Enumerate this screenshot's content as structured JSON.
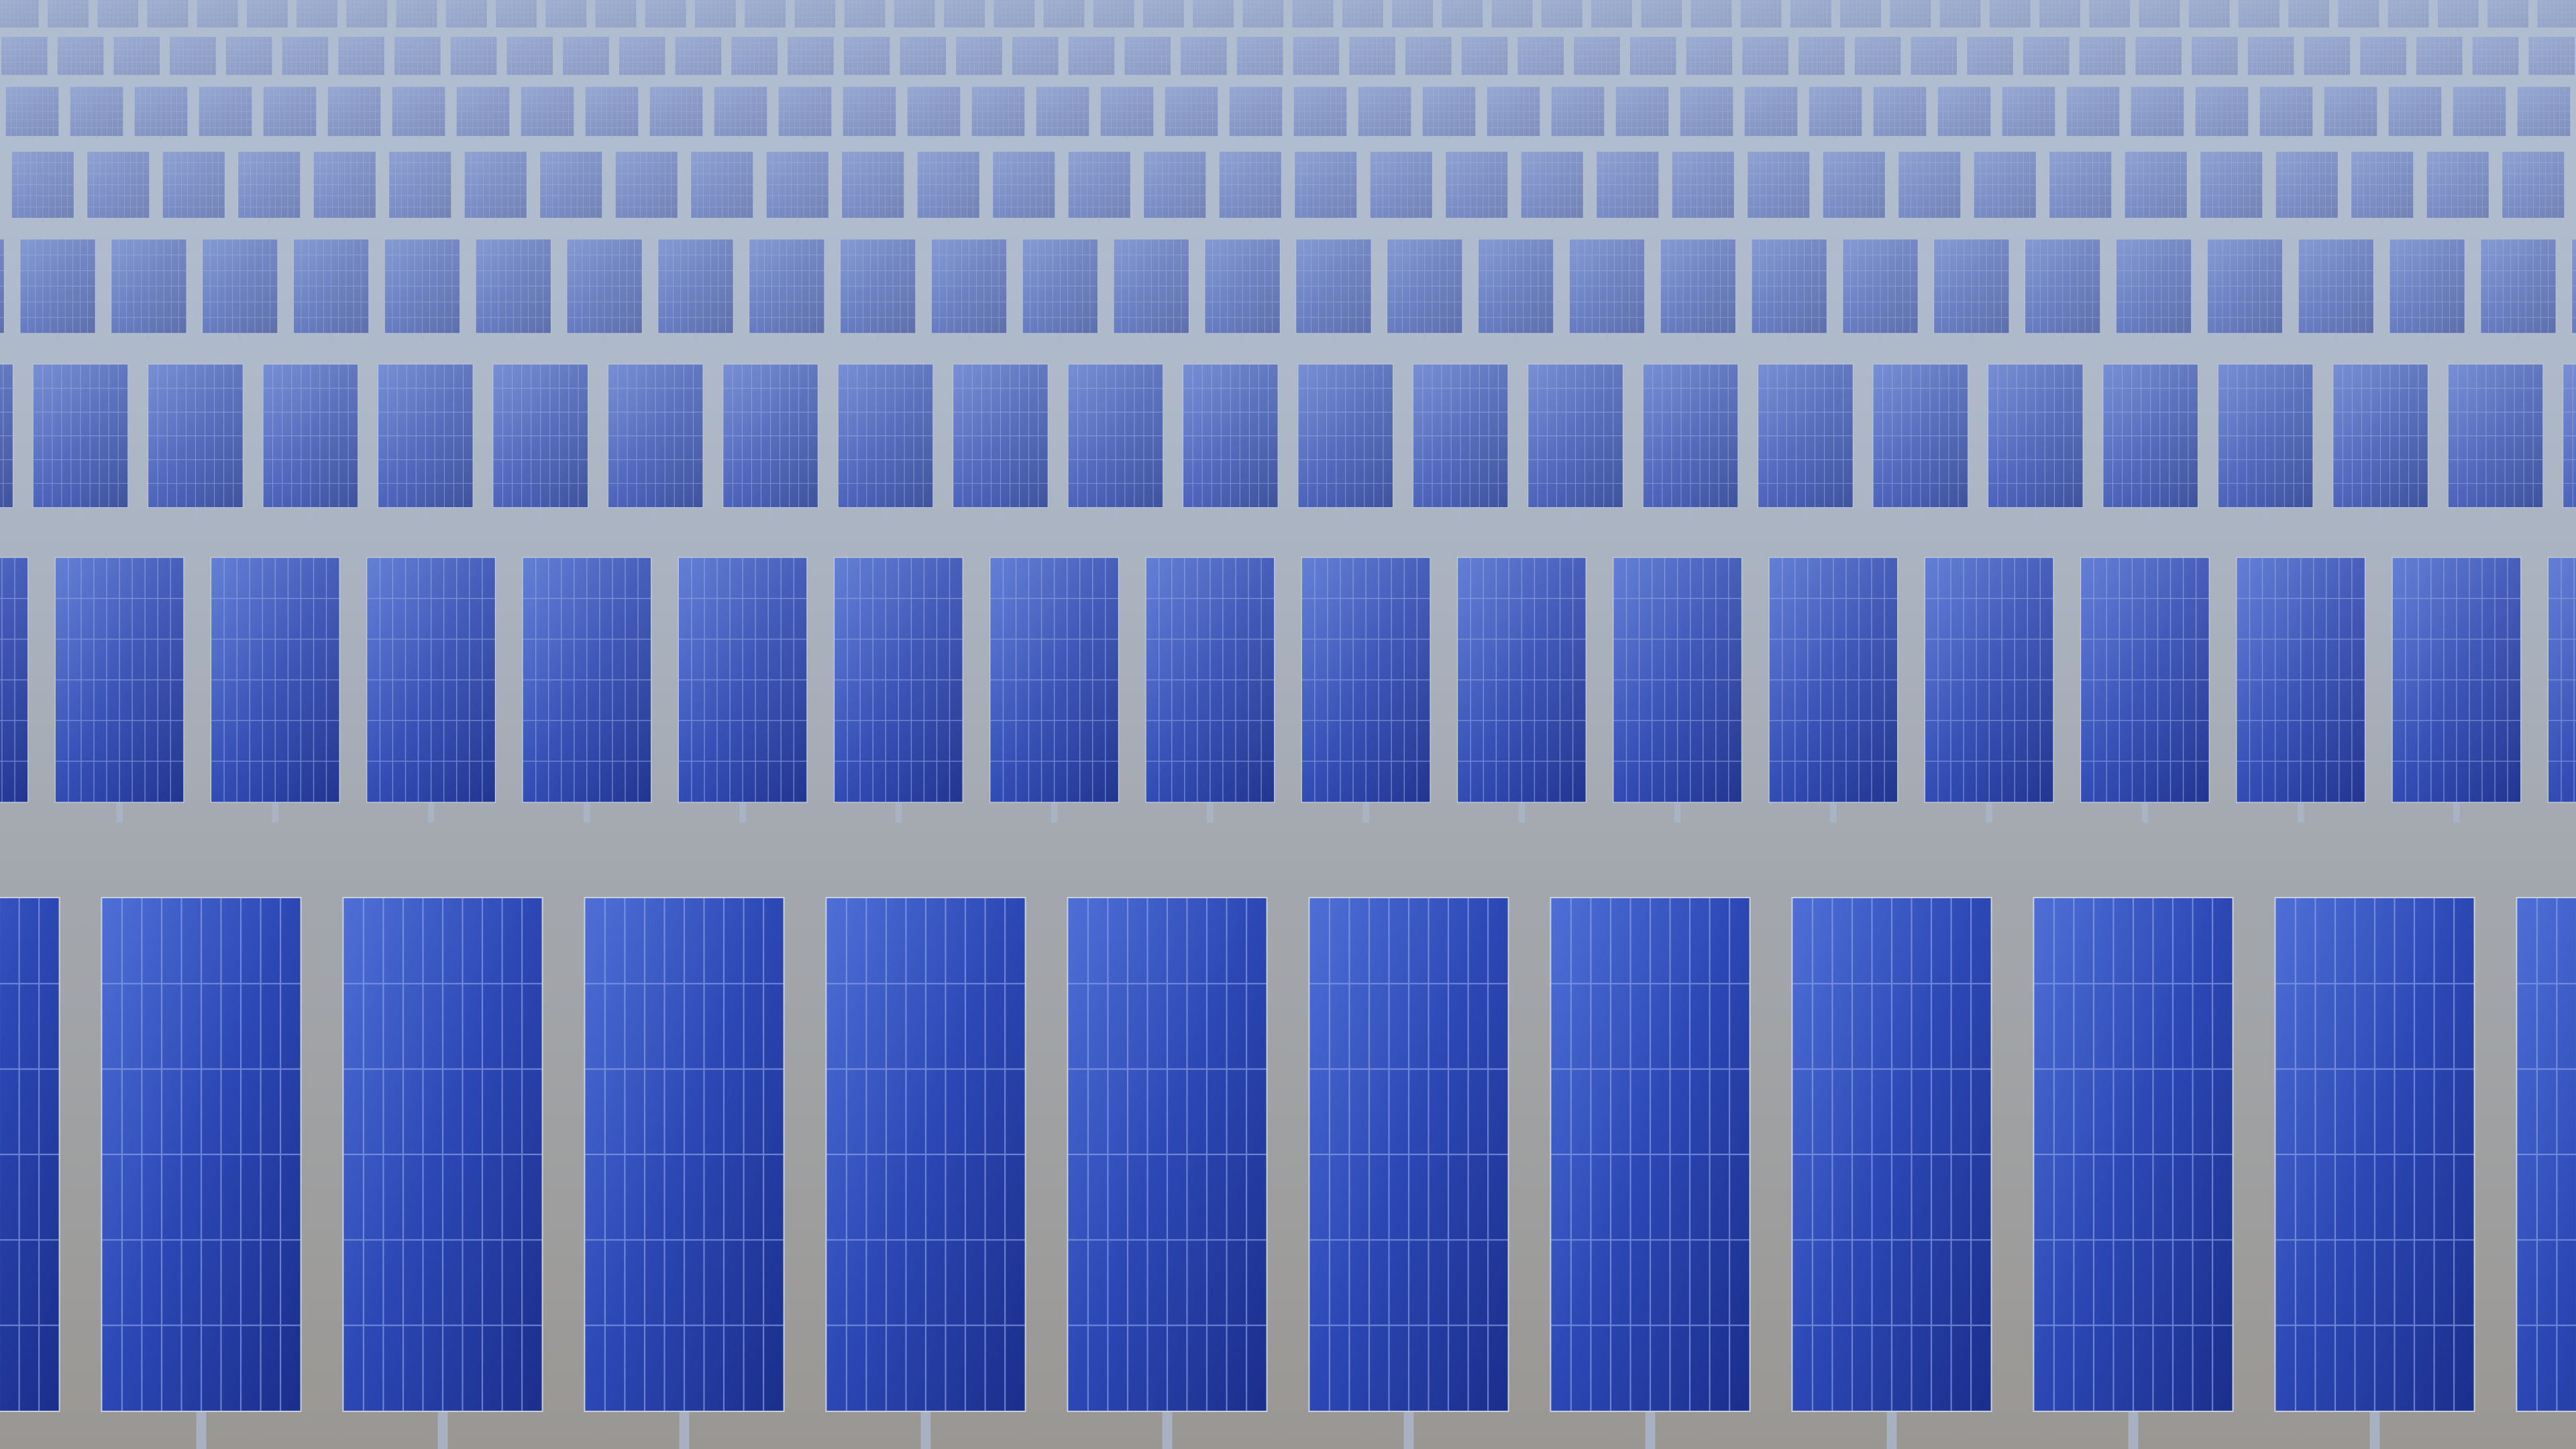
{
  "scene": {
    "subject": "solar-panel-field",
    "colors": {
      "ground_near": "#9a9793",
      "ground_far": "#b7c3d3",
      "haze": "#aebbd0",
      "panel_dark": "#1a2f8c",
      "panel_light": "#4f6fd6",
      "panel_frame": "#c9d0dc",
      "cell_grid": "#8fa6ea",
      "support": "#a9b4c6"
    }
  }
}
